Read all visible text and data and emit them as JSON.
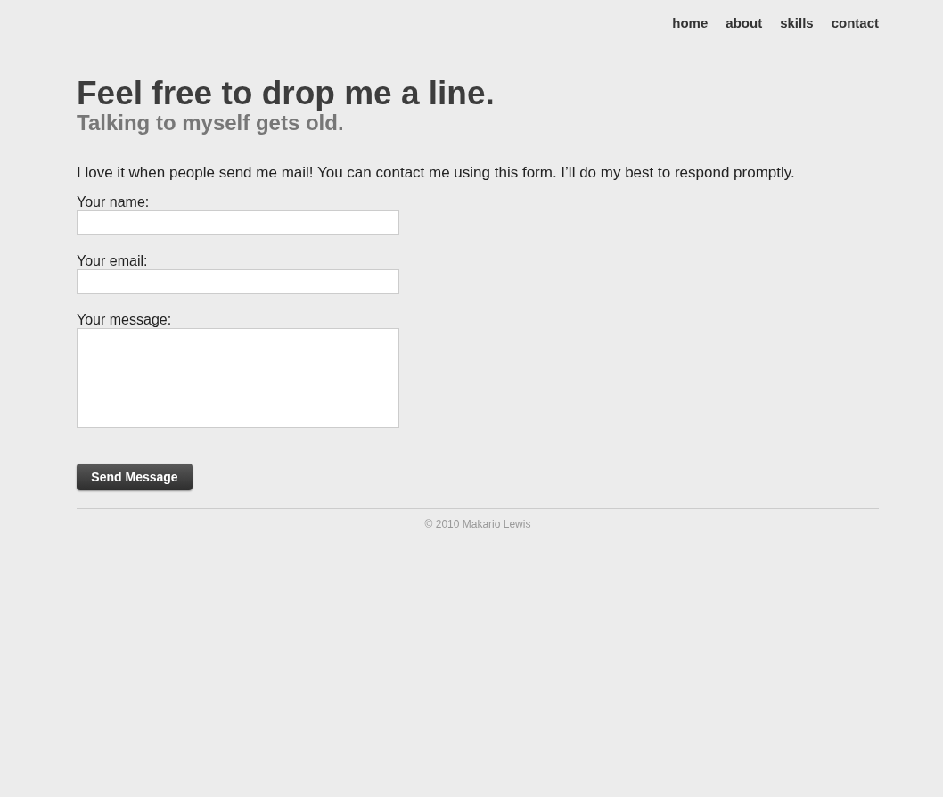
{
  "nav": {
    "items": [
      {
        "label": "home"
      },
      {
        "label": "about"
      },
      {
        "label": "skills"
      },
      {
        "label": "contact"
      }
    ]
  },
  "header": {
    "title": "Feel free to drop me a line.",
    "subtitle": "Talking to myself gets old."
  },
  "intro": "I love it when people send me mail! You can contact me using this form. I’ll do my best to respond promptly.",
  "form": {
    "fields": [
      {
        "label": "Your name:",
        "kind": "text"
      },
      {
        "label": "Your email:",
        "kind": "text"
      },
      {
        "label": "Your message:",
        "kind": "textarea"
      }
    ],
    "submit": "Send Message"
  },
  "footer": "© 2010 Makario Lewis"
}
